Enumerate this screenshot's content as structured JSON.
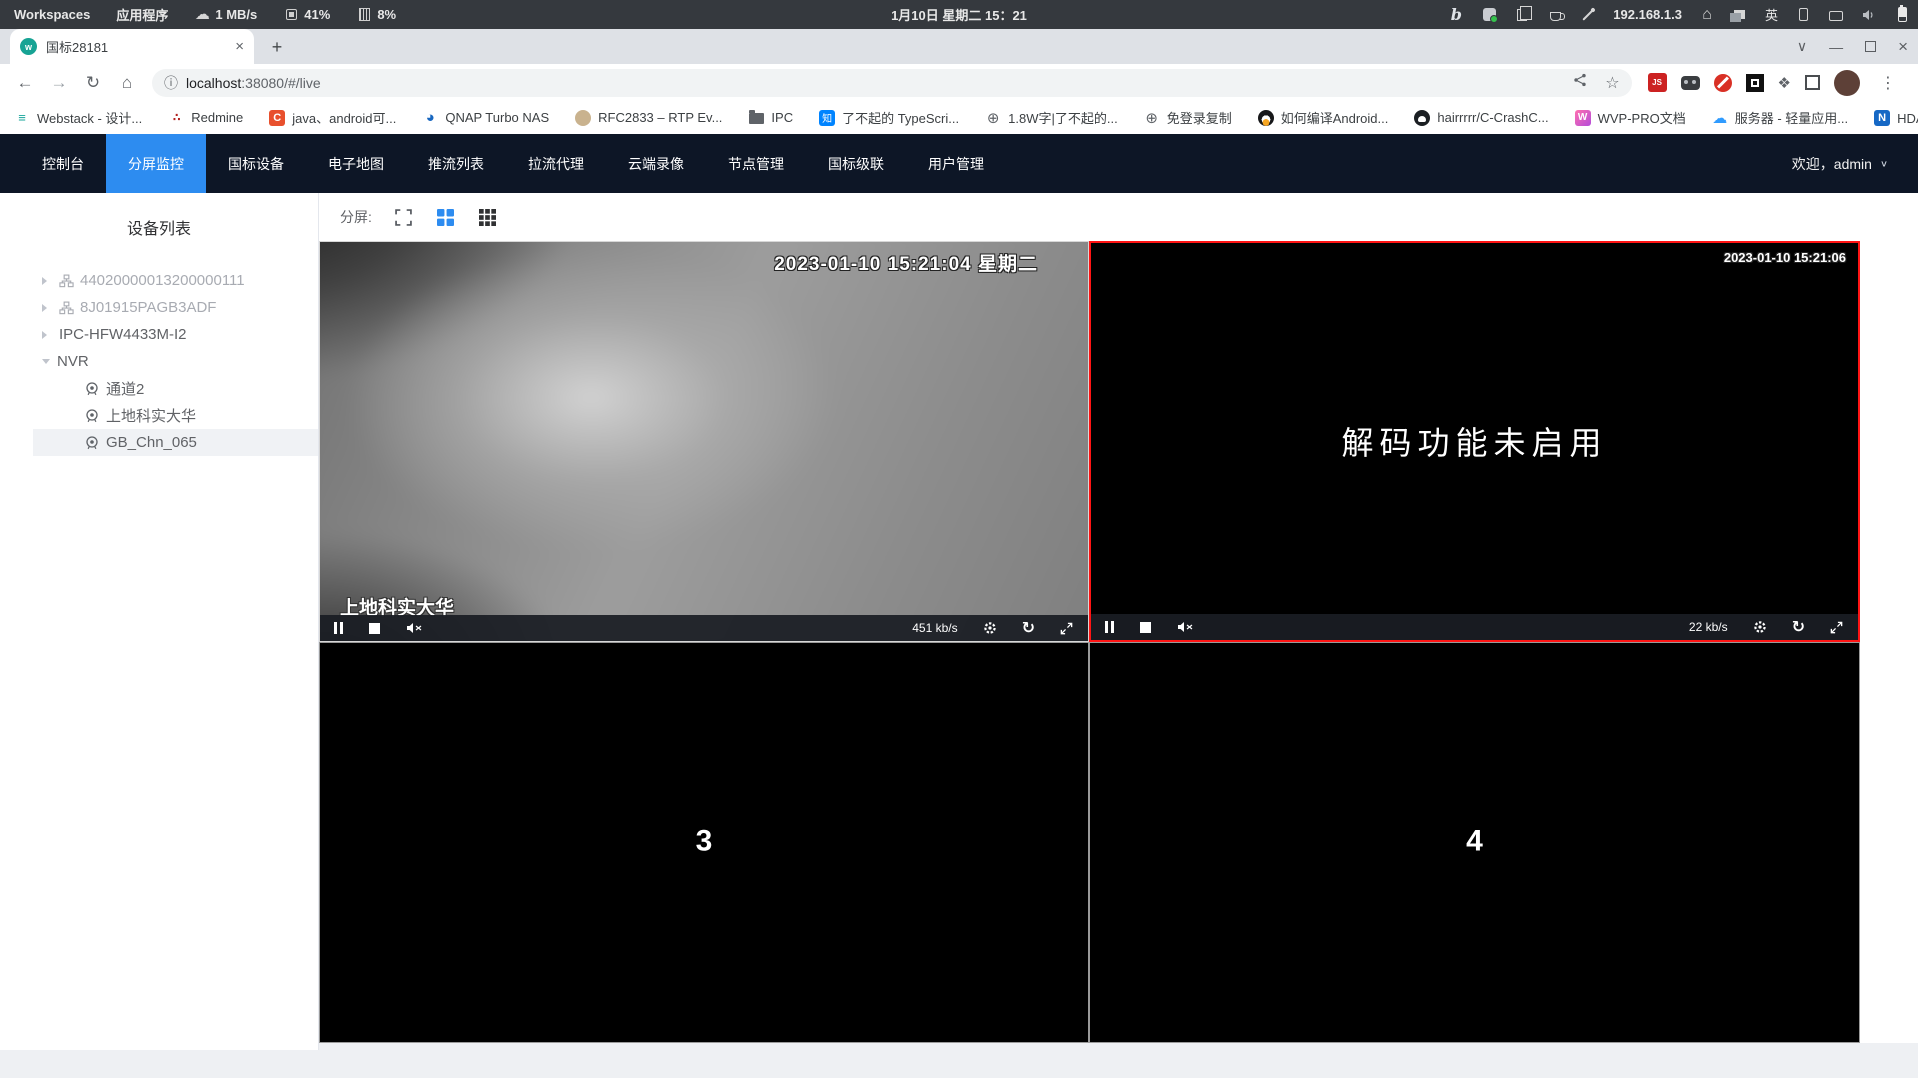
{
  "system_bar": {
    "workspaces": "Workspaces",
    "apps_menu": "应用程序",
    "net_speed": "1 MB/s",
    "cpu": "41%",
    "mem": "8%",
    "clock": "1月10日 星期二 15：21",
    "ip": "192.168.1.3",
    "ime": "英"
  },
  "browser": {
    "tab_title": "国标28181",
    "url_host": "localhost",
    "url_rest": ":38080/#/live",
    "bookmarks": [
      "Webstack - 设计...",
      "Redmine",
      "java、android可...",
      "QNAP Turbo NAS",
      "RFC2833 – RTP Ev...",
      "IPC",
      "了不起的 TypeScri...",
      "1.8W字|了不起的...",
      "免登录复制",
      "如何编译Android...",
      "hairrrrr/C-CrashC...",
      "WVP-PRO文档",
      "服务器 - 轻量应用...",
      "HDAtmos :: 种子 *...",
      "»"
    ]
  },
  "nav": {
    "items": [
      "控制台",
      "分屏监控",
      "国标设备",
      "电子地图",
      "推流列表",
      "拉流代理",
      "云端录像",
      "节点管理",
      "国标级联",
      "用户管理"
    ],
    "active": "分屏监控",
    "welcome": "欢迎，admin"
  },
  "sidebar": {
    "title": "设备列表",
    "tree": [
      {
        "label": "44020000013200000111"
      },
      {
        "label": "8J01915PAGB3ADF"
      },
      {
        "label": "IPC-HFW4433M-I2"
      },
      {
        "label": "NVR"
      },
      {
        "label": "通道2"
      },
      {
        "label": "上地科实大华"
      },
      {
        "label": "GB_Chn_065"
      }
    ]
  },
  "toolbar": {
    "split_label": "分屏:"
  },
  "players": {
    "p1": {
      "osd_time": "2023-01-10 15:21:04 星期二",
      "osd_label": "上地科实大华",
      "bitrate": "451 kb/s"
    },
    "p2": {
      "osd_time": "2023-01-10 15:21:06",
      "message": "解码功能未启用",
      "bitrate": "22 kb/s"
    },
    "p3": {
      "number": "3"
    },
    "p4": {
      "number": "4"
    }
  },
  "colors": {
    "accent": "#2d8cf0",
    "navbar_bg": "#0d1626",
    "selected_border": "#ff1414"
  }
}
